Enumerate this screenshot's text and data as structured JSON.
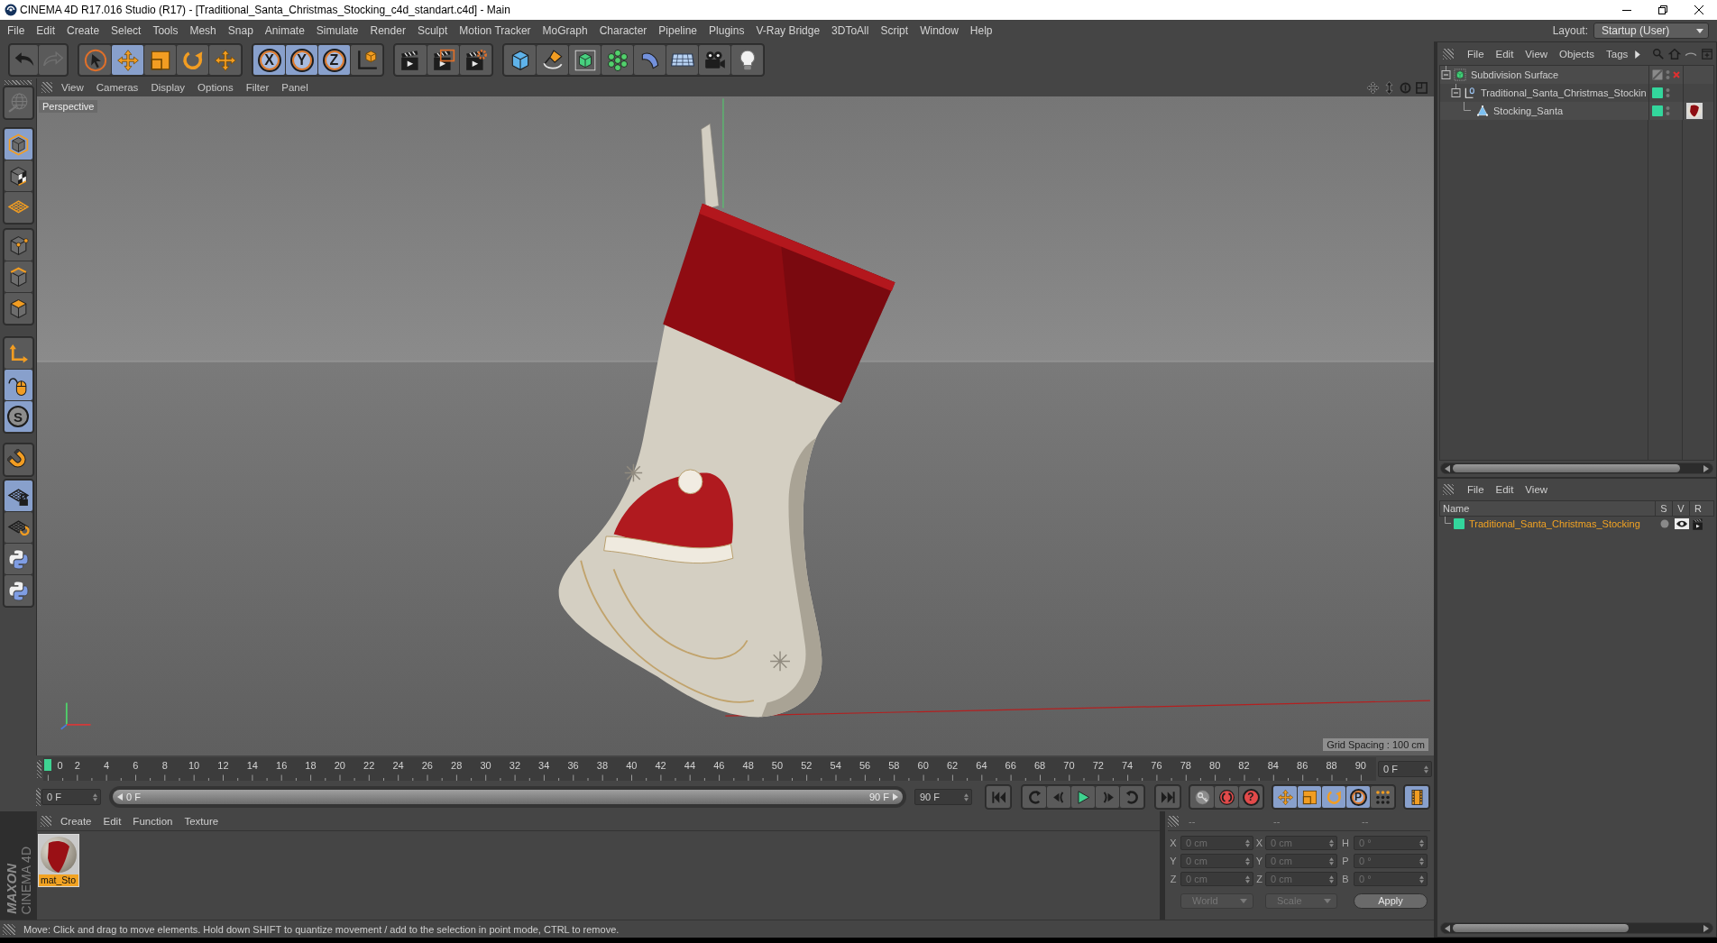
{
  "window": {
    "title": "CINEMA 4D R17.016 Studio (R17) - [Traditional_Santa_Christmas_Stocking_c4d_standart.c4d] - Main"
  },
  "menu_bar": {
    "items": [
      "File",
      "Edit",
      "Create",
      "Select",
      "Tools",
      "Mesh",
      "Snap",
      "Animate",
      "Simulate",
      "Render",
      "Sculpt",
      "Motion Tracker",
      "MoGraph",
      "Character",
      "Pipeline",
      "Plugins",
      "V-Ray Bridge",
      "3DToAll",
      "Script",
      "Window",
      "Help"
    ],
    "layout_label": "Layout:",
    "layout_value": "Startup (User)"
  },
  "toolbar": [
    [
      {
        "kind": "undo",
        "disabled": false
      },
      {
        "kind": "redo",
        "disabled": true
      }
    ],
    [
      {
        "kind": "select",
        "selected": false
      },
      {
        "kind": "move",
        "selected": true
      },
      {
        "kind": "scale",
        "selected": false
      },
      {
        "kind": "rotate",
        "selected": false
      },
      {
        "kind": "last-tool",
        "selected": false
      }
    ],
    [
      {
        "kind": "x-axis",
        "label": "X",
        "selected": true
      },
      {
        "kind": "y-axis",
        "label": "Y",
        "selected": true
      },
      {
        "kind": "z-axis",
        "label": "Z",
        "selected": true
      },
      {
        "kind": "world",
        "selected": false
      }
    ],
    [
      {
        "kind": "render-view"
      },
      {
        "kind": "render-viewer"
      },
      {
        "kind": "render-settings"
      }
    ],
    [
      {
        "kind": "cube"
      },
      {
        "kind": "pen"
      },
      {
        "kind": "subdivision"
      },
      {
        "kind": "cloner"
      },
      {
        "kind": "deformer"
      },
      {
        "kind": "floor"
      },
      {
        "kind": "camera"
      },
      {
        "kind": "light"
      }
    ]
  ],
  "mode_toolbar": [
    [
      {
        "kind": "scene",
        "disabled": true
      }
    ],
    [
      {
        "kind": "model",
        "selected": true
      },
      {
        "kind": "texture",
        "selected": false
      },
      {
        "kind": "workplane",
        "selected": false
      }
    ],
    [
      {
        "kind": "points",
        "selected": false
      },
      {
        "kind": "edges",
        "selected": false
      },
      {
        "kind": "polygons",
        "selected": false
      }
    ],
    [
      {
        "kind": "axis",
        "selected": false
      },
      {
        "kind": "tweak",
        "selected": true
      },
      {
        "kind": "solo",
        "label": "S",
        "selected": true
      }
    ],
    [
      {
        "kind": "snap",
        "selected": false
      }
    ],
    [
      {
        "kind": "lock-workplane",
        "selected": true
      },
      {
        "kind": "planar-workplane",
        "selected": false
      },
      {
        "kind": "python"
      },
      {
        "kind": "python"
      }
    ]
  ],
  "viewport": {
    "menu": [
      "View",
      "Cameras",
      "Display",
      "Options",
      "Filter",
      "Panel"
    ],
    "camera": "Perspective",
    "grid_spacing": "Grid Spacing : 100 cm"
  },
  "object_manager": {
    "menu": [
      "File",
      "Edit",
      "View",
      "Objects",
      "Tags"
    ],
    "objects": [
      {
        "name": "Subdivision Surface",
        "kind": "subdivision",
        "expanded": true,
        "enabled": false,
        "children": [
          {
            "name": "Traditional_Santa_Christmas_Stockin",
            "kind": "null",
            "expanded": true,
            "color": "#33d69c",
            "children": [
              {
                "name": "Stocking_Santa",
                "kind": "polygon",
                "color": "#33d69c",
                "tags": [
                  {
                    "kind": "material"
                  }
                ]
              }
            ]
          }
        ]
      }
    ]
  },
  "layer_manager": {
    "menu": [
      "File",
      "Edit",
      "View"
    ],
    "columns": [
      "Name",
      "S",
      "V",
      "R"
    ],
    "layers": [
      {
        "name": "Traditional_Santa_Christmas_Stocking",
        "color": "#33d69c",
        "selected": true,
        "solo": false,
        "visible": true,
        "render": true
      }
    ]
  },
  "timeline": {
    "frames": [
      "0",
      "2",
      "4",
      "6",
      "8",
      "10",
      "12",
      "14",
      "16",
      "18",
      "20",
      "22",
      "24",
      "26",
      "28",
      "30",
      "32",
      "34",
      "36",
      "38",
      "40",
      "42",
      "44",
      "46",
      "48",
      "50",
      "52",
      "54",
      "56",
      "58",
      "60",
      "62",
      "64",
      "66",
      "68",
      "70",
      "72",
      "74",
      "76",
      "78",
      "80",
      "82",
      "84",
      "86",
      "88",
      "90"
    ],
    "level": 0,
    "current_frame": "0 F"
  },
  "playback": {
    "start_frame": "0 F",
    "range": {
      "start": "0 F",
      "end": "90 F",
      "level": 1
    },
    "end_frame": "90 F",
    "controls": [
      [
        {
          "kind": "go-to-start"
        }
      ],
      [
        {
          "kind": "previous-key"
        },
        {
          "kind": "previous-frame"
        },
        {
          "kind": "play"
        },
        {
          "kind": "next-frame"
        },
        {
          "kind": "next-key"
        }
      ],
      [
        {
          "kind": "go-to-end"
        }
      ],
      [
        {
          "kind": "record-active"
        },
        {
          "kind": "autokey"
        },
        {
          "kind": "keyframe-selection",
          "label": "?"
        }
      ],
      [
        {
          "kind": "position",
          "selected": true
        },
        {
          "kind": "scale",
          "selected": true
        },
        {
          "kind": "rotation",
          "selected": true
        },
        {
          "kind": "parameter",
          "label": "P",
          "selected": true
        },
        {
          "kind": "point-level",
          "selected": false
        }
      ],
      [
        {
          "kind": "timeline",
          "selected": true
        }
      ]
    ]
  },
  "materials": {
    "menu": [
      "Create",
      "Edit",
      "Function",
      "Texture"
    ],
    "items": [
      {
        "name": "mat_Sto",
        "selected": true
      }
    ]
  },
  "coordinates": {
    "headers": [
      "--",
      "--",
      "--"
    ],
    "disabled": true,
    "rows": [
      {
        "labels": [
          "X",
          "X",
          "H"
        ],
        "values": [
          "0 cm",
          "0 cm",
          "0 °"
        ]
      },
      {
        "labels": [
          "Y",
          "Y",
          "P"
        ],
        "values": [
          "0 cm",
          "0 cm",
          "0 °"
        ]
      },
      {
        "labels": [
          "Z",
          "Z",
          "B"
        ],
        "values": [
          "0 cm",
          "0 cm",
          "0 °"
        ]
      }
    ],
    "mode": "World",
    "transform": "Scale",
    "apply": "Apply"
  },
  "branding": {
    "logo": [
      "MAXON",
      "CINEMA 4D"
    ]
  },
  "status_bar": {
    "text": "Move: Click and drag to move elements. Hold down SHIFT to quantize movement / add to the selection in point mode, CTRL to remove."
  }
}
